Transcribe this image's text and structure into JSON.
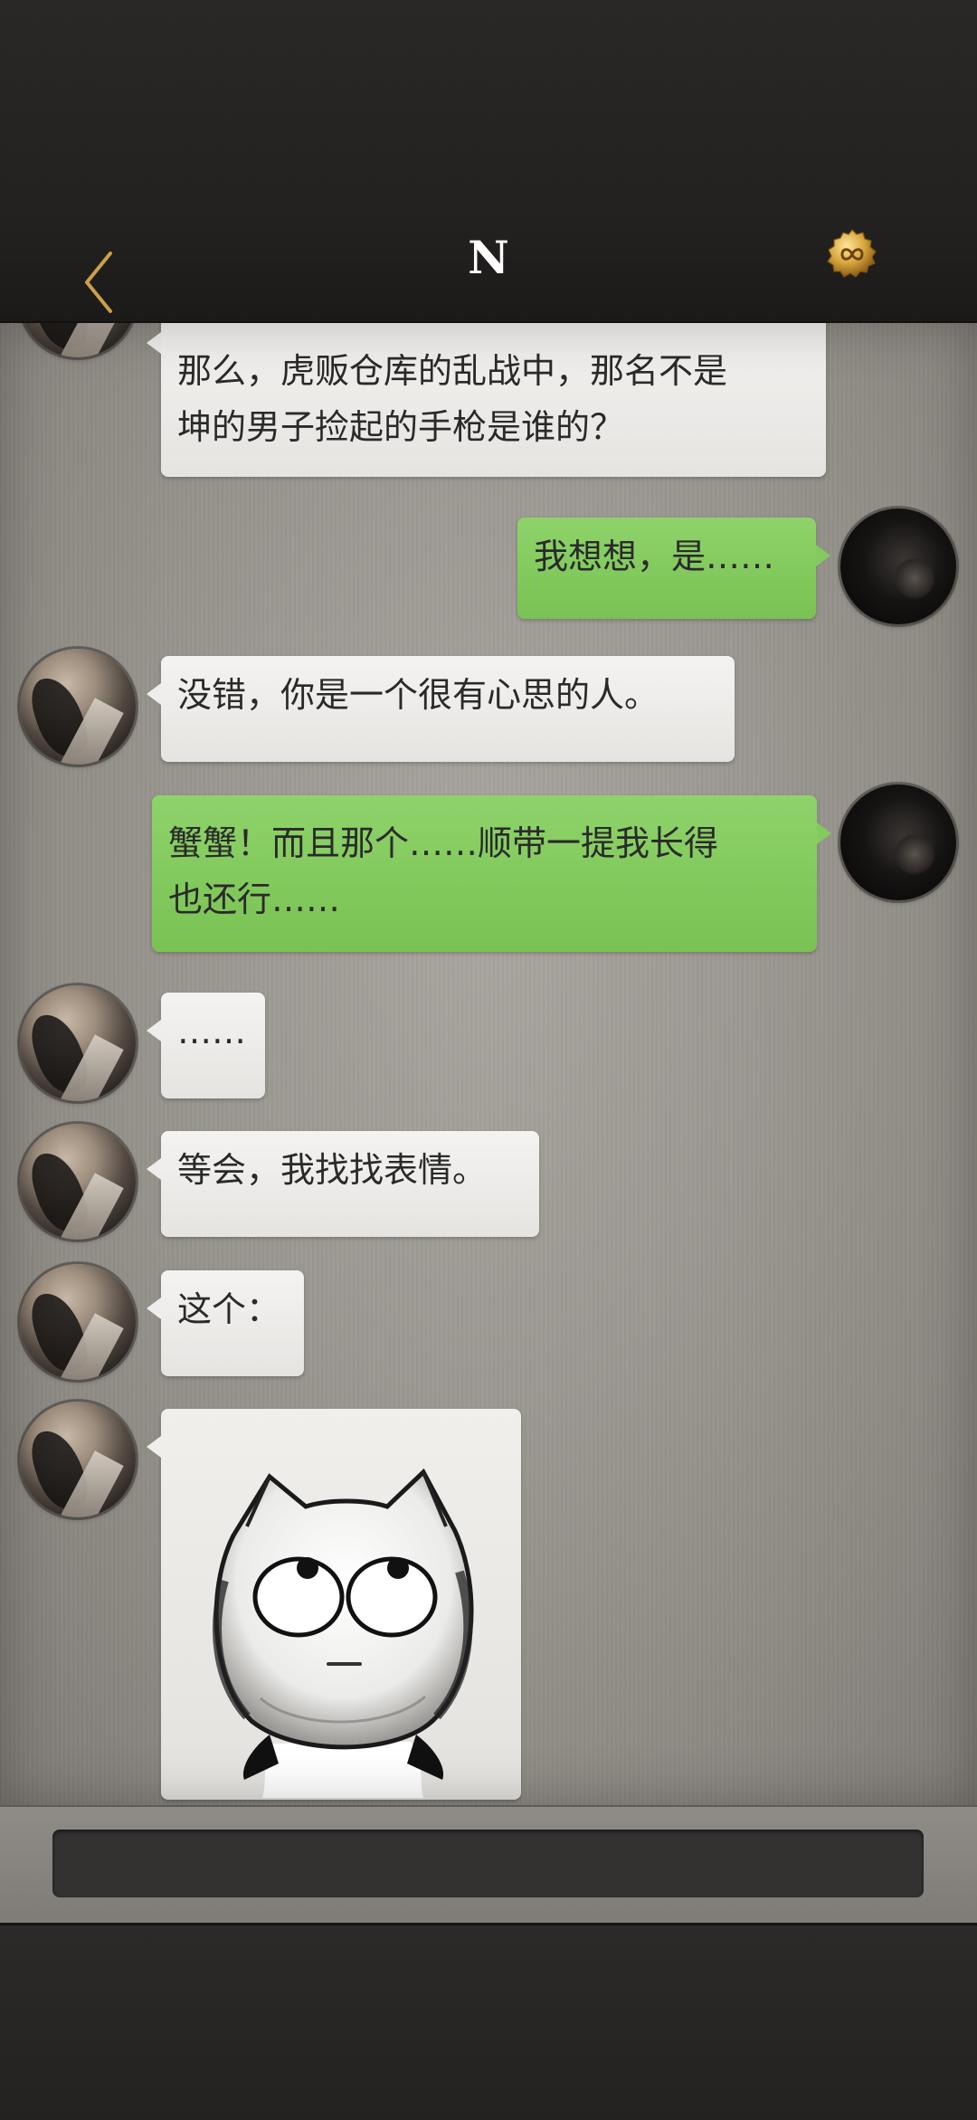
{
  "header": {
    "title": "N",
    "back_icon": "chevron-left-icon",
    "coin_icon": "infinity-coin-icon",
    "accent_color": "#c9a04a"
  },
  "messages": [
    {
      "side": "in",
      "text_lines": [
        "那么，虎贩仓库的乱战中，那名不是",
        "坤的男子捡起的手枪是谁的？"
      ]
    },
    {
      "side": "out",
      "text_lines": [
        "我想想，是……"
      ]
    },
    {
      "side": "in",
      "text_lines": [
        "没错，你是一个很有心思的人。"
      ]
    },
    {
      "side": "out",
      "text_lines": [
        "蟹蟹！而且那个……顺带一提我长得",
        "也还行……"
      ]
    },
    {
      "side": "in",
      "text_lines": [
        "……"
      ]
    },
    {
      "side": "in",
      "text_lines": [
        "等会，我找找表情。"
      ]
    },
    {
      "side": "in",
      "text_lines": [
        "这个："
      ]
    },
    {
      "side": "in",
      "type": "sticker",
      "sticker": "eye-roll-cat-sticker"
    }
  ],
  "input": {
    "value": "",
    "placeholder": ""
  },
  "colors": {
    "incoming_bubble": "#eeedeb",
    "outgoing_bubble": "#84cb5f"
  }
}
